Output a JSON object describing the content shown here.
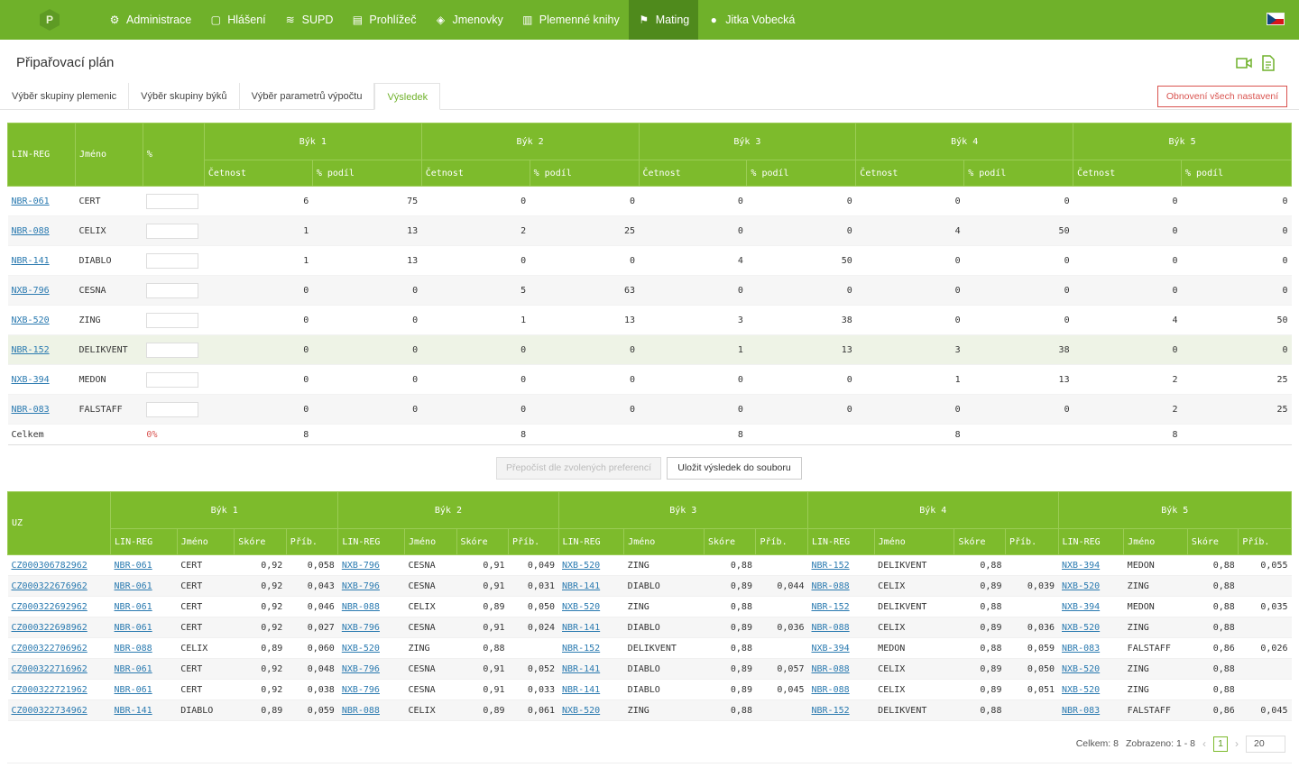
{
  "nav": {
    "logo_letter": "P",
    "items": [
      {
        "label": "Administrace",
        "icon": "gear-icon"
      },
      {
        "label": "Hlášení",
        "icon": "clipboard-icon"
      },
      {
        "label": "SUPD",
        "icon": "database-icon"
      },
      {
        "label": "Prohlížeč",
        "icon": "document-search-icon"
      },
      {
        "label": "Jmenovky",
        "icon": "tag-icon"
      },
      {
        "label": "Plemenné knihy",
        "icon": "book-icon"
      },
      {
        "label": "Mating",
        "icon": "flag-icon",
        "active": true
      },
      {
        "label": "Jitka Vobecká",
        "icon": "user-icon"
      }
    ],
    "language": "cs"
  },
  "page": {
    "title": "Připařovací plán"
  },
  "tabs": [
    {
      "label": "Výběr skupiny plemenic"
    },
    {
      "label": "Výběr skupiny býků"
    },
    {
      "label": "Výběr parametrů výpočtu"
    },
    {
      "label": "Výsledek",
      "active": true
    }
  ],
  "reset_button": "Obnovení všech nastavení",
  "summary": {
    "headers": {
      "linreg": "LIN-REG",
      "name": "Jméno",
      "pct": "%",
      "count": "Četnost",
      "share": "% podíl"
    },
    "bulls": [
      "Býk 1",
      "Býk 2",
      "Býk 3",
      "Býk 4",
      "Býk 5"
    ],
    "rows": [
      {
        "linreg": "NBR-061",
        "name": "CERT",
        "vals": [
          "6",
          "75",
          "0",
          "0",
          "0",
          "0",
          "0",
          "0",
          "0",
          "0"
        ]
      },
      {
        "linreg": "NBR-088",
        "name": "CELIX",
        "vals": [
          "1",
          "13",
          "2",
          "25",
          "0",
          "0",
          "4",
          "50",
          "0",
          "0"
        ]
      },
      {
        "linreg": "NBR-141",
        "name": "DIABLO",
        "vals": [
          "1",
          "13",
          "0",
          "0",
          "4",
          "50",
          "0",
          "0",
          "0",
          "0"
        ]
      },
      {
        "linreg": "NXB-796",
        "name": "CESNA",
        "vals": [
          "0",
          "0",
          "5",
          "63",
          "0",
          "0",
          "0",
          "0",
          "0",
          "0"
        ]
      },
      {
        "linreg": "NXB-520",
        "name": "ZING",
        "vals": [
          "0",
          "0",
          "1",
          "13",
          "3",
          "38",
          "0",
          "0",
          "4",
          "50"
        ]
      },
      {
        "linreg": "NBR-152",
        "name": "DELIKVENT",
        "vals": [
          "0",
          "0",
          "0",
          "0",
          "1",
          "13",
          "3",
          "38",
          "0",
          "0"
        ]
      },
      {
        "linreg": "NXB-394",
        "name": "MEDON",
        "vals": [
          "0",
          "0",
          "0",
          "0",
          "0",
          "0",
          "1",
          "13",
          "2",
          "25"
        ]
      },
      {
        "linreg": "NBR-083",
        "name": "FALSTAFF",
        "vals": [
          "0",
          "0",
          "0",
          "0",
          "0",
          "0",
          "0",
          "0",
          "2",
          "25"
        ]
      }
    ],
    "total": {
      "label": "Celkem",
      "pct": "0%",
      "counts": [
        "8",
        "8",
        "8",
        "8",
        "8"
      ]
    }
  },
  "buttons": {
    "recalc": "Přepočíst dle zvolených preferencí",
    "save": "Uložit výsledek do souboru"
  },
  "results": {
    "headers": {
      "uz": "UZ",
      "linreg": "LIN-REG",
      "name": "Jméno",
      "score": "Skóre",
      "rel": "Příb."
    },
    "bulls": [
      "Býk 1",
      "Býk 2",
      "Býk 3",
      "Býk 4",
      "Býk 5"
    ],
    "rows": [
      {
        "uz": "CZ000306782962",
        "b": [
          [
            "NBR-061",
            "CERT",
            "0,92",
            "0,058"
          ],
          [
            "NXB-796",
            "CESNA",
            "0,91",
            "0,049"
          ],
          [
            "NXB-520",
            "ZING",
            "0,88",
            ""
          ],
          [
            "NBR-152",
            "DELIKVENT",
            "0,88",
            ""
          ],
          [
            "NXB-394",
            "MEDON",
            "0,88",
            "0,055"
          ]
        ]
      },
      {
        "uz": "CZ000322676962",
        "b": [
          [
            "NBR-061",
            "CERT",
            "0,92",
            "0,043"
          ],
          [
            "NXB-796",
            "CESNA",
            "0,91",
            "0,031"
          ],
          [
            "NBR-141",
            "DIABLO",
            "0,89",
            "0,044"
          ],
          [
            "NBR-088",
            "CELIX",
            "0,89",
            "0,039"
          ],
          [
            "NXB-520",
            "ZING",
            "0,88",
            ""
          ]
        ]
      },
      {
        "uz": "CZ000322692962",
        "b": [
          [
            "NBR-061",
            "CERT",
            "0,92",
            "0,046"
          ],
          [
            "NBR-088",
            "CELIX",
            "0,89",
            "0,050"
          ],
          [
            "NXB-520",
            "ZING",
            "0,88",
            ""
          ],
          [
            "NBR-152",
            "DELIKVENT",
            "0,88",
            ""
          ],
          [
            "NXB-394",
            "MEDON",
            "0,88",
            "0,035"
          ]
        ]
      },
      {
        "uz": "CZ000322698962",
        "b": [
          [
            "NBR-061",
            "CERT",
            "0,92",
            "0,027"
          ],
          [
            "NXB-796",
            "CESNA",
            "0,91",
            "0,024"
          ],
          [
            "NBR-141",
            "DIABLO",
            "0,89",
            "0,036"
          ],
          [
            "NBR-088",
            "CELIX",
            "0,89",
            "0,036"
          ],
          [
            "NXB-520",
            "ZING",
            "0,88",
            ""
          ]
        ]
      },
      {
        "uz": "CZ000322706962",
        "b": [
          [
            "NBR-088",
            "CELIX",
            "0,89",
            "0,060"
          ],
          [
            "NXB-520",
            "ZING",
            "0,88",
            ""
          ],
          [
            "NBR-152",
            "DELIKVENT",
            "0,88",
            ""
          ],
          [
            "NXB-394",
            "MEDON",
            "0,88",
            "0,059"
          ],
          [
            "NBR-083",
            "FALSTAFF",
            "0,86",
            "0,026"
          ]
        ]
      },
      {
        "uz": "CZ000322716962",
        "b": [
          [
            "NBR-061",
            "CERT",
            "0,92",
            "0,048"
          ],
          [
            "NXB-796",
            "CESNA",
            "0,91",
            "0,052"
          ],
          [
            "NBR-141",
            "DIABLO",
            "0,89",
            "0,057"
          ],
          [
            "NBR-088",
            "CELIX",
            "0,89",
            "0,050"
          ],
          [
            "NXB-520",
            "ZING",
            "0,88",
            ""
          ]
        ]
      },
      {
        "uz": "CZ000322721962",
        "b": [
          [
            "NBR-061",
            "CERT",
            "0,92",
            "0,038"
          ],
          [
            "NXB-796",
            "CESNA",
            "0,91",
            "0,033"
          ],
          [
            "NBR-141",
            "DIABLO",
            "0,89",
            "0,045"
          ],
          [
            "NBR-088",
            "CELIX",
            "0,89",
            "0,051"
          ],
          [
            "NXB-520",
            "ZING",
            "0,88",
            ""
          ]
        ]
      },
      {
        "uz": "CZ000322734962",
        "b": [
          [
            "NBR-141",
            "DIABLO",
            "0,89",
            "0,059"
          ],
          [
            "NBR-088",
            "CELIX",
            "0,89",
            "0,061"
          ],
          [
            "NXB-520",
            "ZING",
            "0,88",
            ""
          ],
          [
            "NBR-152",
            "DELIKVENT",
            "0,88",
            ""
          ],
          [
            "NBR-083",
            "FALSTAFF",
            "0,86",
            "0,045"
          ]
        ]
      }
    ]
  },
  "pager": {
    "total": "Celkem: 8",
    "shown": "Zobrazeno: 1 - 8",
    "page": "1",
    "page_size": "20"
  },
  "colors": {
    "brand": "#6fb12a",
    "nav_active": "#4f8a1c",
    "header": "#7dbb2c",
    "link": "#2a7ab0",
    "danger": "#d9534f"
  }
}
